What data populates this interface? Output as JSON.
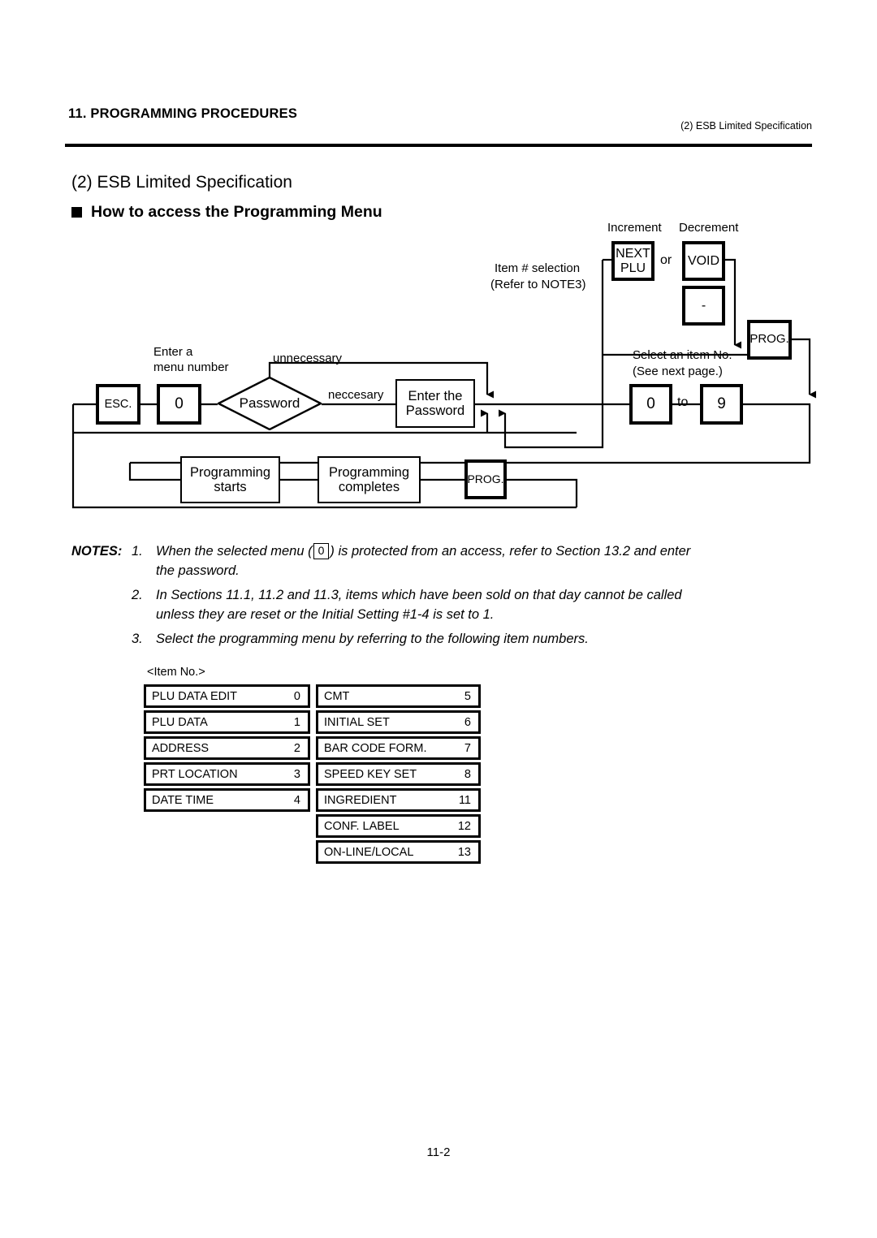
{
  "header": {
    "title": "11. PROGRAMMING PROCEDURES",
    "subtitle": "(2) ESB Limited Specification"
  },
  "section": {
    "title": "(2) ESB Limited Specification",
    "subtitle": "How to access the Programming Menu"
  },
  "flowchart": {
    "labels": {
      "increment": "Increment",
      "decrement": "Decrement",
      "item_selection_line1": "Item # selection",
      "item_selection_line2": "(Refer to NOTE3)",
      "or": "or",
      "select_item_line1": "Select an item No.",
      "select_item_line2": "(See next page.)",
      "enter_menu_line1": "Enter a",
      "enter_menu_line2": "menu number",
      "unnecessary": "unnecessary",
      "neccesary": "neccesary",
      "to": "to"
    },
    "nodes": {
      "next_plu_line1": "NEXT",
      "next_plu_line2": "PLU",
      "void": "VOID",
      "minus": "-",
      "prog_top": "PROG.",
      "prog_bottom": "PROG.",
      "esc": "ESC.",
      "menu_zero": "0",
      "password_decision": "Password",
      "enter_password_line1": "Enter the",
      "enter_password_line2": "Password",
      "item_from": "0",
      "item_to": "9",
      "programming_starts_line1": "Programming",
      "programming_starts_line2": "starts",
      "programming_completes_line1": "Programming",
      "programming_completes_line2": "completes"
    }
  },
  "notes": {
    "label": "NOTES:",
    "items": [
      {
        "number": "1.",
        "text_before": "When the selected menu (",
        "key": "0",
        "text_after": ") is protected from an access, refer to Section 13.2 and enter",
        "continuation": "the password."
      },
      {
        "number": "2.",
        "text": "In Sections 11.1, 11.2 and 11.3, items which have been sold on that day cannot be called",
        "continuation": "unless they are reset or the Initial Setting #1-4 is set to 1."
      },
      {
        "number": "3.",
        "text": "Select the programming menu by referring to the following item numbers.",
        "continuation": ""
      }
    ]
  },
  "item_no_table": {
    "caption": "<Item No.>",
    "left_column": [
      {
        "name": "PLU DATA EDIT",
        "num": "0"
      },
      {
        "name": "PLU DATA",
        "num": "1"
      },
      {
        "name": "ADDRESS",
        "num": "2"
      },
      {
        "name": "PRT LOCATION",
        "num": "3"
      },
      {
        "name": "DATE TIME",
        "num": "4"
      }
    ],
    "right_column": [
      {
        "name": "CMT",
        "num": "5"
      },
      {
        "name": "INITIAL SET",
        "num": "6"
      },
      {
        "name": "BAR CODE FORM.",
        "num": "7"
      },
      {
        "name": "SPEED KEY SET",
        "num": "8"
      },
      {
        "name": "INGREDIENT",
        "num": "11"
      },
      {
        "name": "CONF. LABEL",
        "num": "12"
      },
      {
        "name": "ON-LINE/LOCAL",
        "num": "13"
      }
    ]
  },
  "footer": {
    "page_number": "11-2"
  }
}
